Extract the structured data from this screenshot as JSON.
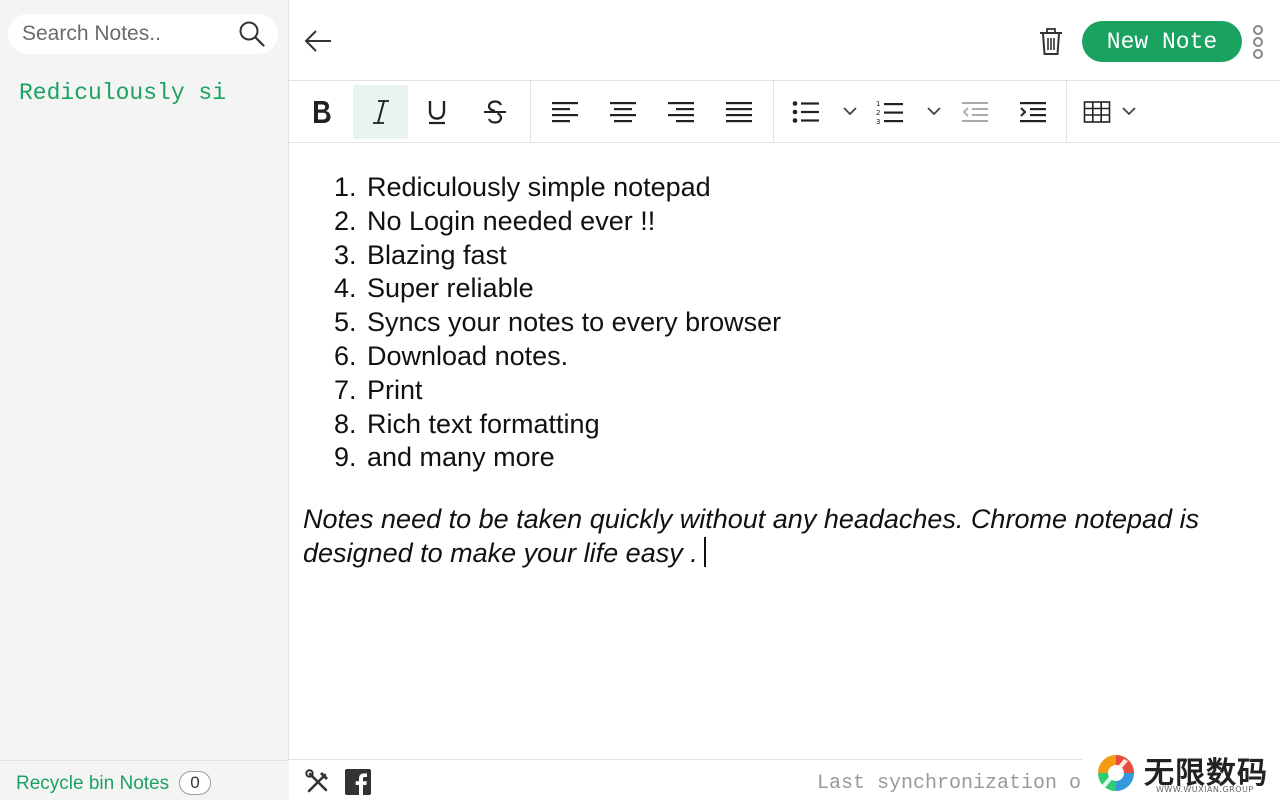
{
  "sidebar": {
    "search": {
      "placeholder": "Search Notes.."
    },
    "notes": [
      {
        "title": "Rediculously si"
      }
    ],
    "footer": {
      "recycle_label": "Recycle bin Notes",
      "recycle_count": "0"
    }
  },
  "header": {
    "new_note_label": "New Note",
    "icons": {
      "back": "arrow-left-icon",
      "trash": "trash-icon",
      "more": "vertical-dots-icon"
    }
  },
  "toolbar": {
    "buttons": [
      {
        "name": "bold",
        "icon": "bold-icon"
      },
      {
        "name": "italic",
        "icon": "italic-icon",
        "active": true
      },
      {
        "name": "underline",
        "icon": "underline-icon"
      },
      {
        "name": "strikethrough",
        "icon": "strikethrough-icon"
      },
      {
        "name": "align-left",
        "icon": "align-left-icon"
      },
      {
        "name": "align-center",
        "icon": "align-center-icon"
      },
      {
        "name": "align-right",
        "icon": "align-right-icon"
      },
      {
        "name": "justify",
        "icon": "justify-icon"
      },
      {
        "name": "bulleted-list",
        "icon": "bulleted-list-icon"
      },
      {
        "name": "numbered-list",
        "icon": "numbered-list-icon"
      },
      {
        "name": "outdent",
        "icon": "outdent-icon"
      },
      {
        "name": "indent",
        "icon": "indent-icon"
      },
      {
        "name": "table",
        "icon": "table-icon"
      }
    ]
  },
  "editor": {
    "list_items": [
      "Rediculously simple notepad",
      "No Login needed ever !!",
      "Blazing fast",
      "Super reliable",
      "Syncs your notes to every browser",
      "Download notes.",
      "Print",
      "Rich text formatting",
      "and many more"
    ],
    "tagline": "Notes need to be taken quickly without any headaches. Chrome notepad is designed to make your life easy ."
  },
  "bottom_bar": {
    "sync_text": "Last synchronization on",
    "icons": {
      "tools": "tools-icon",
      "facebook": "facebook-icon"
    }
  },
  "watermark": {
    "text": "无限数码",
    "subtext": "WWW.WUXIAN.GROUP"
  },
  "colors": {
    "accent": "#1aa260",
    "sidebar_bg": "#f4f4f4",
    "active_bg": "#e8f4ee"
  }
}
